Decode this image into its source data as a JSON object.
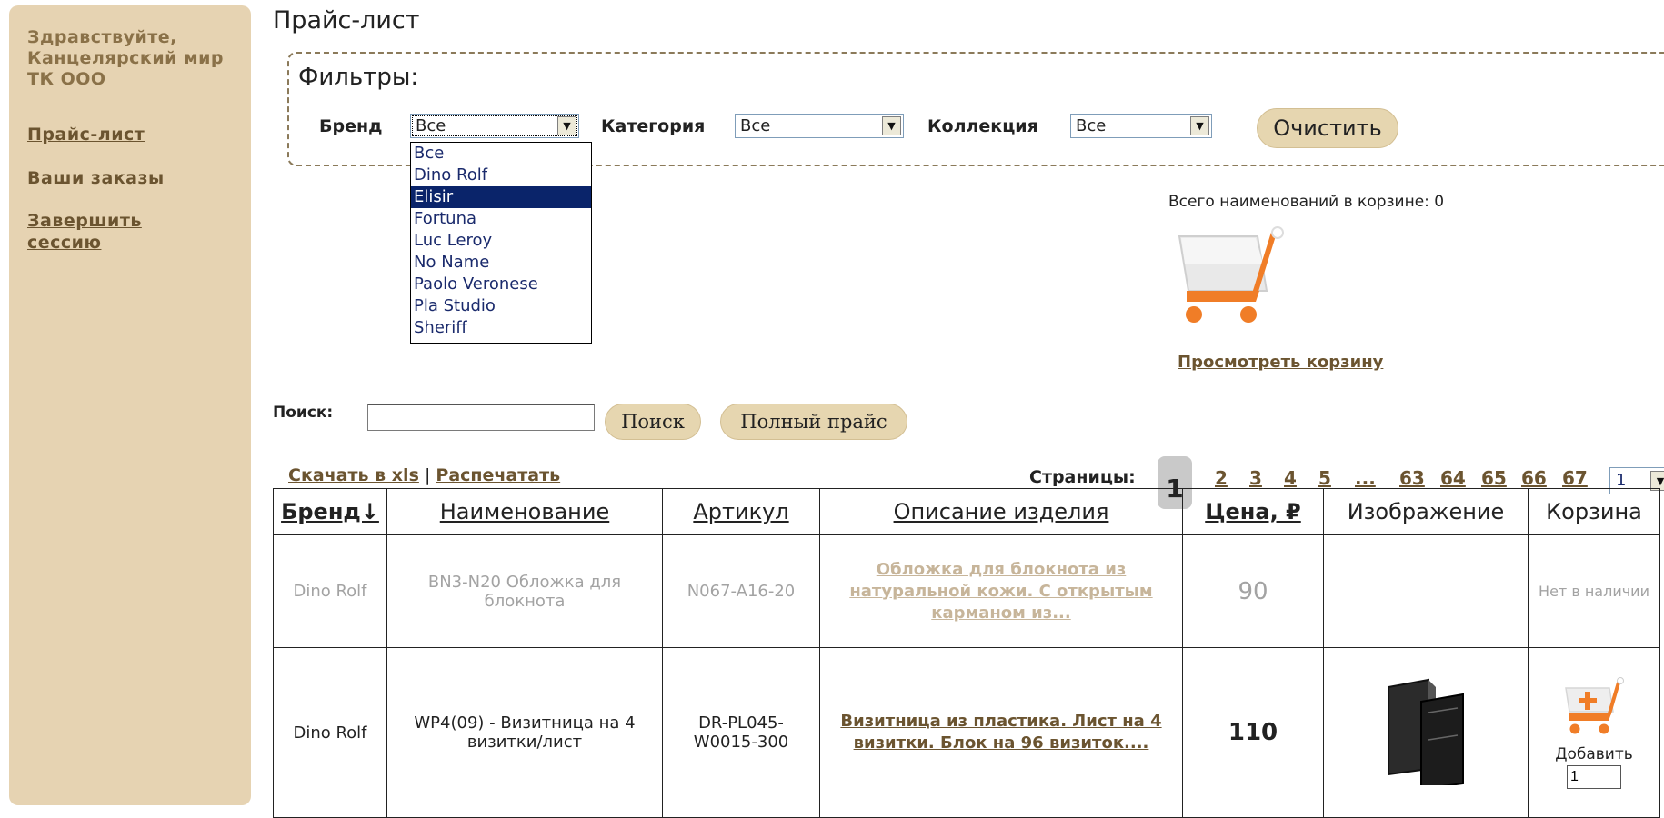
{
  "sidebar": {
    "greeting": "Здравствуйте, Канцелярский мир ТК ООО",
    "links": [
      "Прайс-лист",
      "Ваши заказы",
      "Завершить сессию"
    ]
  },
  "page_title": "Прайс-лист",
  "filters": {
    "legend": "Фильтры:",
    "brand_label": "Бренд",
    "brand_value": "Все",
    "category_label": "Категория",
    "category_value": "Все",
    "collection_label": "Коллекция",
    "collection_value": "Все",
    "clear_button": "Очистить",
    "brand_options": [
      "Все",
      "Dino Rolf",
      "Elisir",
      "Fortuna",
      "Luc Leroy",
      "No Name",
      "Paolo Veronese",
      "Pla Studio",
      "Sheriff"
    ],
    "brand_highlighted": "Elisir"
  },
  "cart": {
    "total_text": "Всего наименований в корзине: 0",
    "view_link": "Просмотреть корзину"
  },
  "search": {
    "label": "Поиск:",
    "value": "",
    "search_button": "Поиск",
    "full_price_button": "Полный прайс"
  },
  "links": {
    "download_xls": "Скачать в xls",
    "separator": "|",
    "print": "Распечатать"
  },
  "pagination": {
    "label": "Страницы:",
    "current": "1",
    "pages": [
      "2",
      "3",
      "4",
      "5",
      "...",
      "63",
      "64",
      "65",
      "66",
      "67"
    ],
    "select_value": "1"
  },
  "table": {
    "headers": [
      "Бренд↓",
      "Наименование",
      "Артикул",
      "Описание изделия",
      "Цена, ₽",
      "Изображение",
      "Корзина"
    ],
    "rows": [
      {
        "brand": "Dino Rolf",
        "name": "BN3-N20 Обложка для блокнота",
        "article": "N067-A16-20",
        "description": "Обложка для блокнота из натуральной кожи. С открытым карманом из...",
        "price": "90",
        "cart_status": "Нет в наличии"
      },
      {
        "brand": "Dino Rolf",
        "name": "WP4(09) - Визитница на 4 визитки/лист",
        "article": "DR-PL045-W0015-300",
        "description": "Визитница из пластика. Лист на 4 визитки. Блок на 96 визиток....",
        "price": "110",
        "add_label": "Добавить",
        "qty": "1"
      }
    ]
  },
  "colors": {
    "sidebar_bg": "#e6d3b2",
    "link": "#6b5430",
    "button_bg": "#e6d6b0",
    "cart_orange": "#f07d27"
  }
}
